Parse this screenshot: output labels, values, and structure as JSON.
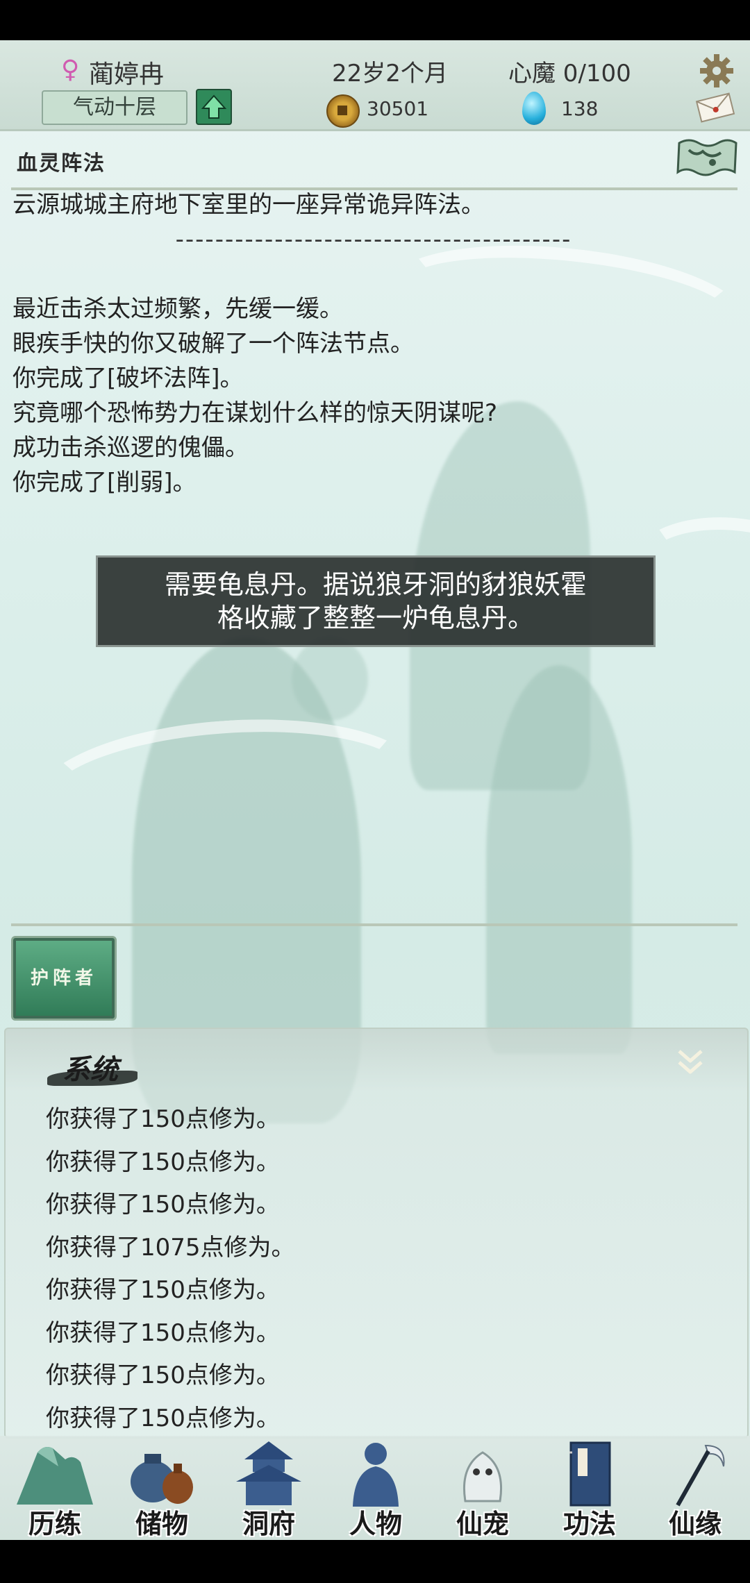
{
  "header": {
    "gender_symbol": "♀",
    "name": "蔺婷冉",
    "realm": "气动十层",
    "age": "22岁2个月",
    "demon": "心魔  0/100",
    "money": "30501",
    "gems": "138"
  },
  "location": {
    "title": "血灵阵法"
  },
  "story": {
    "description": "云源城城主府地下室里的一座异常诡异阵法。",
    "divider": "----------------------------------------",
    "lines": [
      "最近击杀太过频繁，先缓一缓。",
      "眼疾手快的你又破解了一个阵法节点。",
      "你完成了[破坏法阵]。",
      "究竟哪个恐怖势力在谋划什么样的惊天阴谋呢?",
      "成功击杀巡逻的傀儡。",
      "你完成了[削弱]。"
    ]
  },
  "toast": {
    "line1": "需要龟息丹。据说狼牙洞的豺狼妖霍",
    "line2": "格收藏了整整一炉龟息丹。"
  },
  "npc_button": "护阵者",
  "system": {
    "title": "系统",
    "rows": [
      "你获得了150点修为。",
      "你获得了150点修为。",
      "你获得了150点修为。",
      "你获得了1075点修为。",
      "你获得了150点修为。",
      "你获得了150点修为。",
      "你获得了150点修为。",
      "你获得了150点修为。"
    ]
  },
  "nav": {
    "items": [
      {
        "label": "历练",
        "icon": "mountain-icon"
      },
      {
        "label": "储物",
        "icon": "bag-icon"
      },
      {
        "label": "洞府",
        "icon": "pagoda-icon"
      },
      {
        "label": "人物",
        "icon": "person-icon"
      },
      {
        "label": "仙宠",
        "icon": "pet-icon"
      },
      {
        "label": "功法",
        "icon": "book-icon"
      },
      {
        "label": "仙缘",
        "icon": "staff-icon"
      }
    ]
  },
  "colors": {
    "accent_green": "#2f8a5a",
    "toast_bg": "#282d2c"
  }
}
